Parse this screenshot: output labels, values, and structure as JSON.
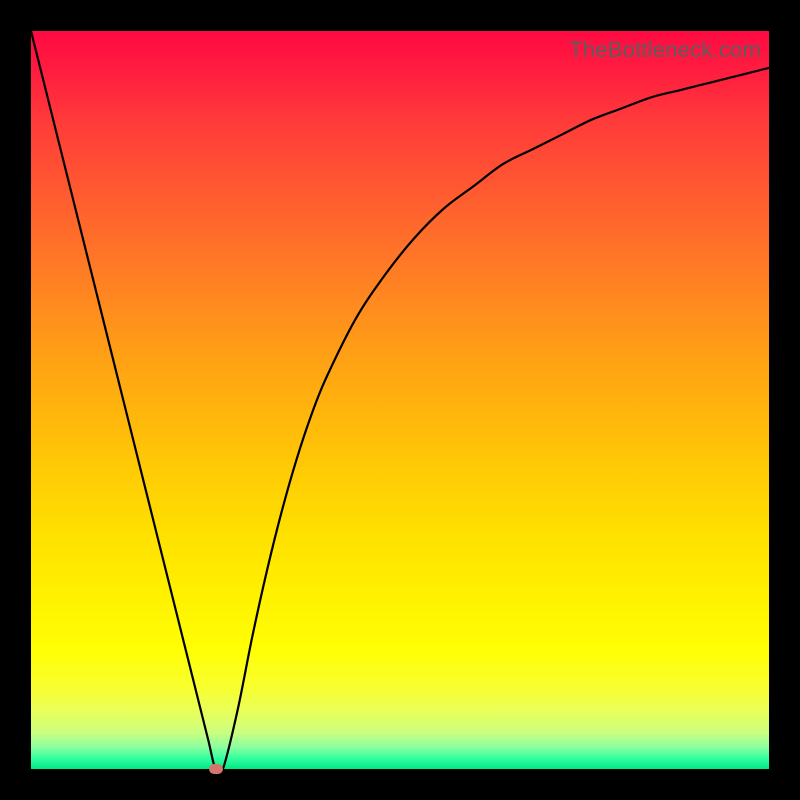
{
  "watermark": "TheBottleneck.com",
  "colors": {
    "frame": "#000000",
    "curve": "#000000",
    "marker": "#d4756e",
    "gradient_top": "#ff0a42",
    "gradient_bottom": "#00e887"
  },
  "chart_data": {
    "type": "line",
    "title": "",
    "xlabel": "",
    "ylabel": "",
    "xlim": [
      0,
      100
    ],
    "ylim": [
      0,
      100
    ],
    "x": [
      0,
      2,
      4,
      6,
      8,
      10,
      12,
      14,
      16,
      18,
      20,
      22,
      24,
      25,
      26,
      28,
      30,
      32,
      34,
      36,
      38,
      40,
      44,
      48,
      52,
      56,
      60,
      64,
      68,
      72,
      76,
      80,
      84,
      88,
      92,
      96,
      100
    ],
    "y": [
      100,
      92,
      84,
      76,
      68,
      60,
      52,
      44,
      36,
      28,
      20,
      12,
      4,
      0,
      0,
      8,
      18,
      27,
      35,
      42,
      48,
      53,
      61,
      67,
      72,
      76,
      79,
      82,
      84,
      86,
      88,
      89.5,
      91,
      92,
      93,
      94,
      95
    ],
    "marker": {
      "x": 25,
      "y": 0
    }
  }
}
